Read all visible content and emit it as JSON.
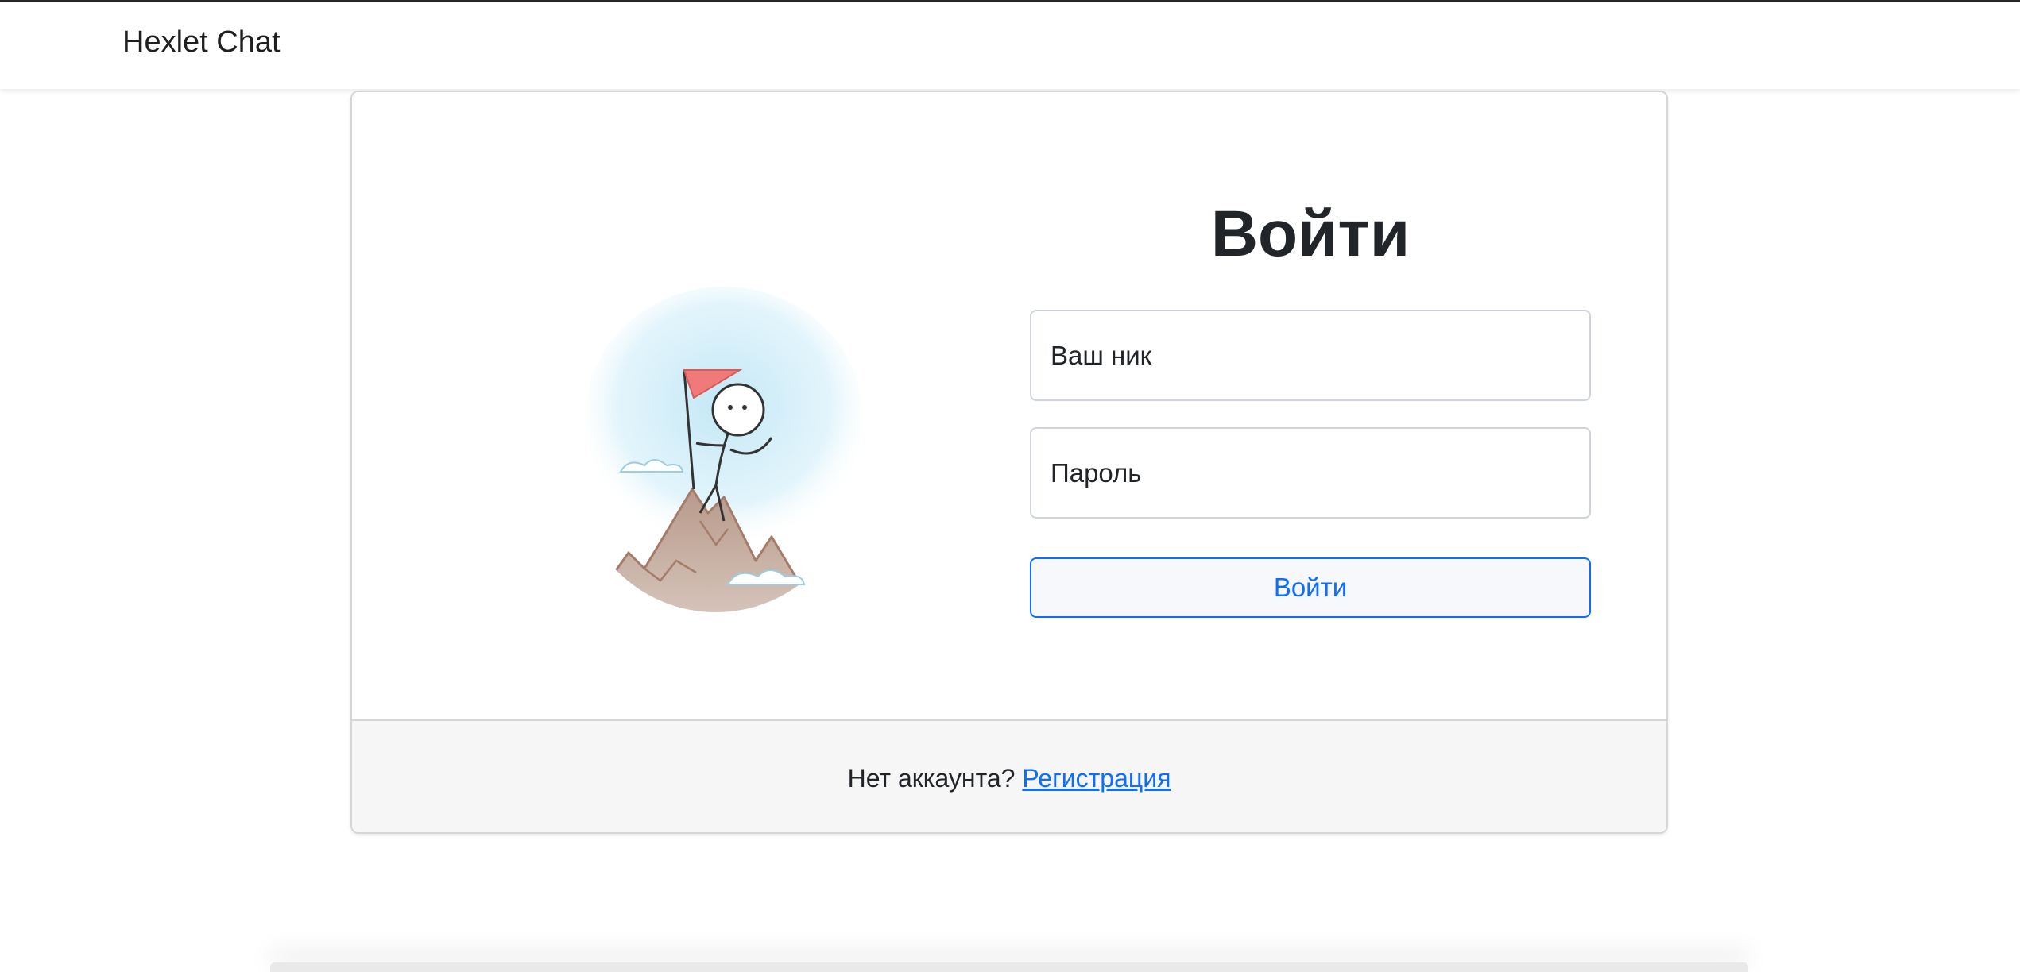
{
  "navbar": {
    "brand": "Hexlet Chat"
  },
  "login": {
    "title": "Войти",
    "nickname_placeholder": "Ваш ник",
    "password_placeholder": "Пароль",
    "submit_label": "Войти"
  },
  "footer": {
    "question": "Нет аккаунта?",
    "signup_link": "Регистрация"
  },
  "illustration": {
    "icon": "mountain-climber-illustration"
  },
  "colors": {
    "accent": "#0d6efd",
    "flag": "#f07a7a",
    "sky": "#bfe6f5",
    "mountain": "#b89a8a",
    "footer_bg": "#f6f6f6"
  }
}
